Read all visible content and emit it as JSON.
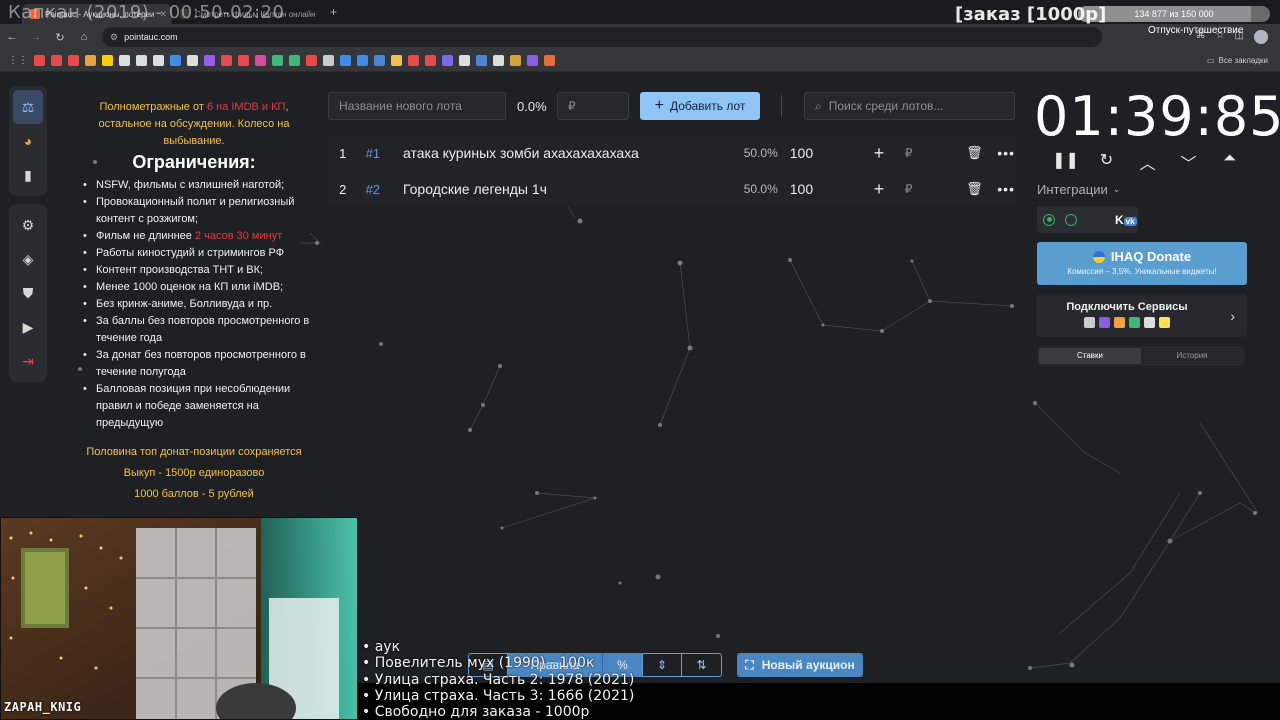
{
  "stream": {
    "title": "Капкан (2019) - 00:50-02:20",
    "order_title": "[заказ [1000р]",
    "goal_text": "134 877 из 150 000",
    "goal_progress": 0.899,
    "goal_caption": "Отпуск-путешествие"
  },
  "browser": {
    "tabs": [
      {
        "label": "Pointauc - Аукционы, лотереи"
      },
      {
        "label": "Смотреть фильм Капкан онлайн"
      }
    ],
    "url": "pointauc.com",
    "bookmarks_all": "Все закладки",
    "bookmark_colors": [
      "#e84a4a",
      "#e84a4a",
      "#e84a4a",
      "#e8a23d",
      "#ffcc00",
      "#dddddd",
      "#dddddd",
      "#dddddd",
      "#3d8ee8",
      "#dddddd",
      "#9b5de8",
      "#e84a4a",
      "#e84a4a",
      "#d84aa0",
      "#3db87a",
      "#3db87a",
      "#e84a4a",
      "#cccccc",
      "#3d8ee8",
      "#3d8ee8",
      "#4a86d8",
      "#f2c14b",
      "#e84a4a",
      "#e84a4a",
      "#7a6ae8",
      "#dddddd",
      "#4a86d8",
      "#dddddd",
      "#d8a23d",
      "#8a5de8",
      "#e86a3d"
    ]
  },
  "nav": {
    "items": [
      {
        "icon": "gavel-icon",
        "glyph": "⚖"
      },
      {
        "icon": "wheel-icon",
        "glyph": "◕"
      },
      {
        "icon": "stats-icon",
        "glyph": "▮"
      },
      {
        "icon": "settings-icon",
        "glyph": "⚙"
      },
      {
        "icon": "layers-icon",
        "glyph": "◈"
      },
      {
        "icon": "shield-icon",
        "glyph": "⛊"
      },
      {
        "icon": "video-icon",
        "glyph": "▶"
      },
      {
        "icon": "logout-icon",
        "glyph": "⇥"
      }
    ]
  },
  "rules": {
    "intro_a": "Полнометражные от ",
    "intro_red": "6 на IMDB и КП",
    "intro_b": ", остальное на обсуждении. Колесо на выбывание.",
    "heading": "Ограничения:",
    "items": [
      "NSFW, фильмы с излишней наготой;",
      "Провокационный полит и религиозный контент с розжигом;",
      "Фильм не длиннее ",
      "Работы киностудий и стримингов РФ",
      "Контент производства ТНТ и ВК;",
      "Менее 1000 оценок на КП или iMDB;",
      "Без кринж-аниме, Болливуда и пр.",
      "За баллы без повторов просмотренного в течение года",
      "За донат без повторов просмотренного в течение полугода",
      "Балловая позиция при несоблюдении правил и победе заменяется на предыдущую"
    ],
    "length_red": "2 часов 30 минут",
    "footer": [
      "Половина топ донат-позиции сохраняется",
      "Выкуп - 1500р единоразово",
      "1000 баллов - 5 рублей"
    ]
  },
  "toolbar": {
    "lot_name_placeholder": "Название нового лота",
    "percent": "0.0%",
    "amount_placeholder": "₽",
    "add_button": "Добавить лот",
    "search_placeholder": "Поиск среди лотов..."
  },
  "lots": [
    {
      "index": "1",
      "tag": "#1",
      "name": "атака куриных зомби ахахахахахаха",
      "percent": "50.0%",
      "amount": "100"
    },
    {
      "index": "2",
      "tag": "#2",
      "name": "Городские легенды 1ч",
      "percent": "50.0%",
      "amount": "100"
    }
  ],
  "timer": {
    "value": "01:39:85",
    "controls": [
      "pause-icon",
      "restart-icon",
      "chevron-up-icon",
      "chevron-down-icon",
      "double-chevron-up-icon"
    ]
  },
  "integrations": {
    "label": "Интеграции",
    "vk": "K"
  },
  "donate": {
    "title": "IHAQ Donate",
    "subtitle": "Комиссия – 3,5%. Уникальные виджеты!"
  },
  "connect": {
    "title": "Подключить Сервисы",
    "logo_colors": [
      "#cccccc",
      "#8a5de8",
      "#f2a23d",
      "#3db87a",
      "#dddddd",
      "#ffe14a"
    ]
  },
  "tabs": {
    "bids": "Ставки",
    "history": "История"
  },
  "bottom": {
    "rules": "Правила",
    "percent": "%",
    "new_auction": "Новый аукцион"
  },
  "webcam": {
    "name": "ZAPAH_KNIG"
  },
  "overlay": {
    "lines": [
      "• аук",
      "• Повелитель мух (1990) - 100к",
      "• Улица страха. Часть 2: 1978 (2021)",
      "• Улица страха. Часть 3: 1666 (2021)",
      "• Свободно для заказа - 1000р"
    ]
  }
}
